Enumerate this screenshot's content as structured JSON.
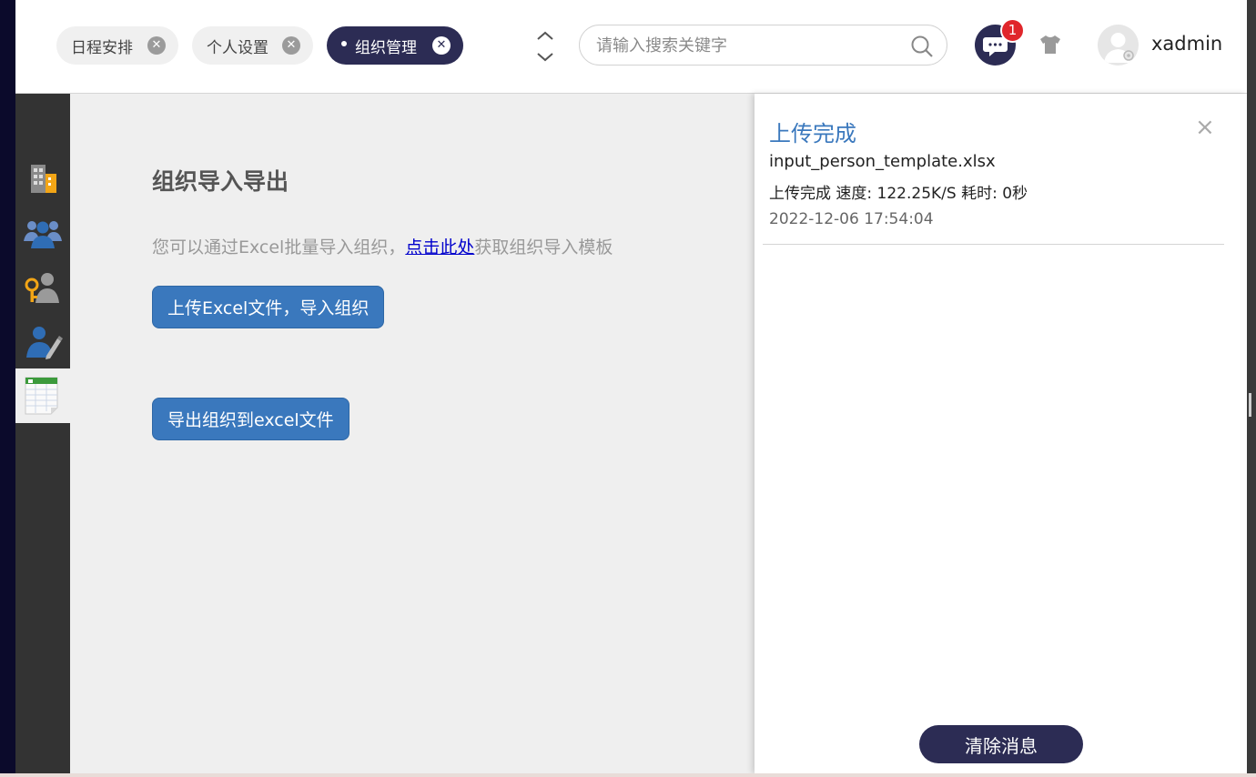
{
  "header": {
    "tabs": [
      {
        "label": "日程安排",
        "active": false
      },
      {
        "label": "个人设置",
        "active": false
      },
      {
        "label": "组织管理",
        "active": true
      }
    ],
    "search": {
      "placeholder": "请输入搜索关键字",
      "value": ""
    },
    "notification_count": "1",
    "username": "xadmin"
  },
  "sidebar": {
    "items": [
      {
        "icon": "building-icon",
        "active": false
      },
      {
        "icon": "users-group-icon",
        "active": false
      },
      {
        "icon": "user-key-icon",
        "active": false
      },
      {
        "icon": "user-edit-icon",
        "active": false
      },
      {
        "icon": "spreadsheet-icon",
        "active": true
      }
    ]
  },
  "main": {
    "title": "组织导入导出",
    "desc_before": "您可以通过Excel批量导入组织，",
    "desc_link": "点击此处",
    "desc_after": "获取组织导入模板",
    "upload_button": "上传Excel文件，导入组织",
    "export_button": "导出组织到excel文件"
  },
  "panel": {
    "title": "上传完成",
    "close_glyph": "×",
    "file_name": "input_person_template.xlsx",
    "speed_text": "上传完成 速度: 122.25K/S 耗时: 0秒",
    "timestamp": "2022-12-06 17:54:04",
    "clear_button": "清除消息"
  },
  "colors": {
    "accent_dark": "#2c2c54",
    "primary_blue": "#3a78bd",
    "badge_red": "#e0262b",
    "sidebar_bg": "#333333"
  }
}
